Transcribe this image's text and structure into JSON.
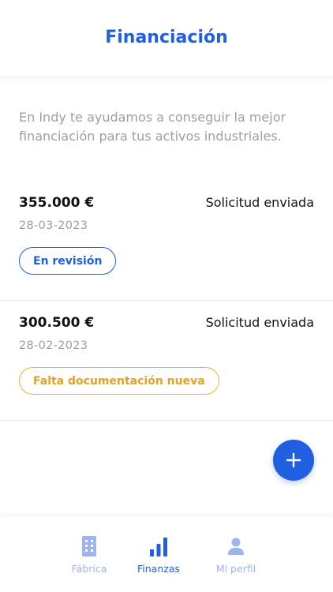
{
  "header": {
    "title": "Financiación"
  },
  "intro": "En Indy te ayudamos a conseguir la mejor financiación para tus activos industriales.",
  "requests": [
    {
      "amount": "355.000 €",
      "status": "Solicitud enviada",
      "date": "28-03-2023",
      "badge": "En revisión",
      "badge_color": "#1f5fe0"
    },
    {
      "amount": "300.500 €",
      "status": "Solicitud enviada",
      "date": "28-02-2023",
      "badge": "Falta documentación nueva",
      "badge_color": "#e2a321"
    }
  ],
  "fab": {
    "icon": "plus-icon"
  },
  "tabs": [
    {
      "label": "Fábrica",
      "icon": "building-icon",
      "active": false
    },
    {
      "label": "Finanzas",
      "icon": "bar-chart-icon",
      "active": true
    },
    {
      "label": "Mi perfil",
      "icon": "user-icon",
      "active": false
    }
  ],
  "colors": {
    "accent": "#1f5fe0",
    "warning": "#e2a321",
    "muted": "#9aa0a8",
    "tab_inactive": "#9db4f0"
  }
}
